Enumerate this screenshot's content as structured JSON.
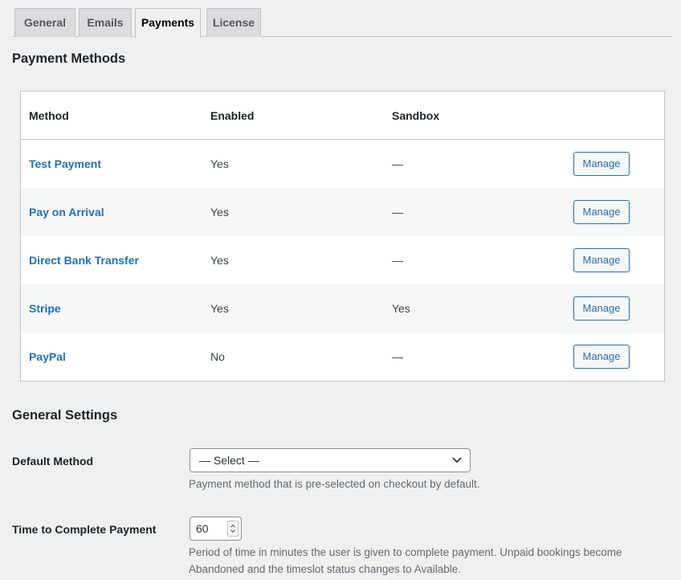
{
  "tabs": [
    {
      "label": "General"
    },
    {
      "label": "Emails"
    },
    {
      "label": "Payments",
      "active": true
    },
    {
      "label": "License"
    }
  ],
  "payment_methods": {
    "heading": "Payment Methods",
    "columns": [
      "Method",
      "Enabled",
      "Sandbox"
    ],
    "rows": [
      {
        "method": "Test Payment",
        "enabled": "Yes",
        "sandbox": "—",
        "action": "Manage"
      },
      {
        "method": "Pay on Arrival",
        "enabled": "Yes",
        "sandbox": "—",
        "action": "Manage"
      },
      {
        "method": "Direct Bank Transfer",
        "enabled": "Yes",
        "sandbox": "—",
        "action": "Manage"
      },
      {
        "method": "Stripe",
        "enabled": "Yes",
        "sandbox": "Yes",
        "action": "Manage"
      },
      {
        "method": "PayPal",
        "enabled": "No",
        "sandbox": "—",
        "action": "Manage"
      }
    ]
  },
  "general_settings": {
    "heading": "General Settings",
    "default_method": {
      "label": "Default Method",
      "value": "— Select —",
      "description": "Payment method that is pre-selected on checkout by default."
    },
    "time_to_complete": {
      "label": "Time to Complete Payment",
      "value": "60",
      "description_line1": "Period of time in minutes the user is given to complete payment. Unpaid bookings become",
      "description_line2": "Abandoned and the timeslot status changes to Available."
    }
  },
  "colors": {
    "link": "#2271b1",
    "background": "#f0f0f1",
    "border": "#c3c4c7"
  },
  "icons": {
    "select_arrow": "chevron-down-icon",
    "number_spinner": "spinner-arrows-icon"
  }
}
